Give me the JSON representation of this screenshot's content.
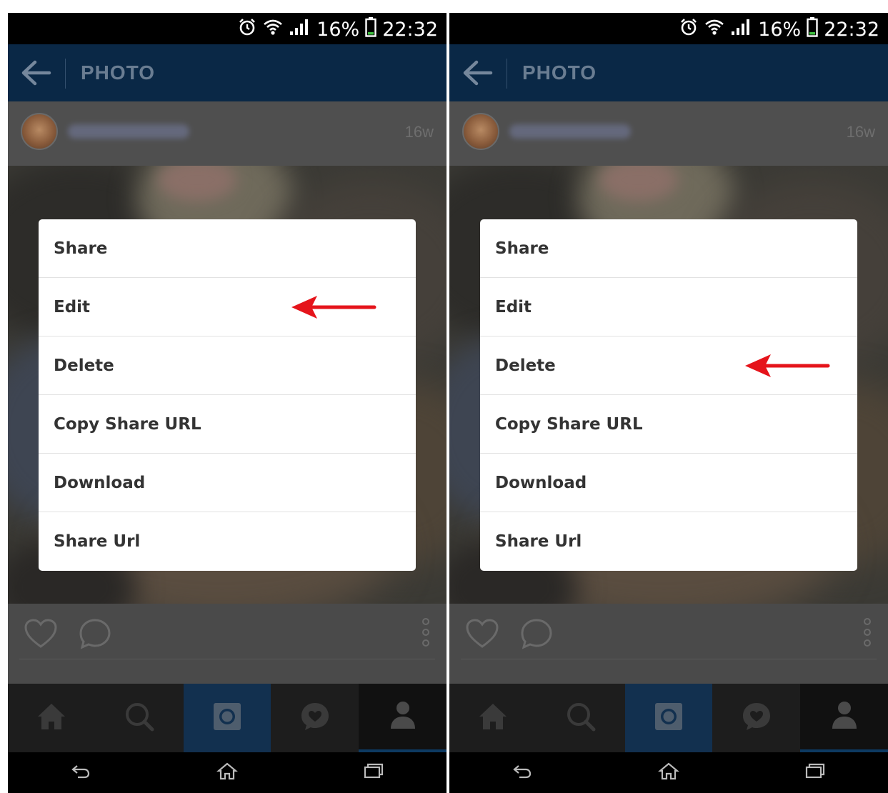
{
  "status_bar": {
    "battery_percent": "16%",
    "time": "22:32",
    "icons": [
      "alarm-icon",
      "wifi-icon",
      "signal-icon",
      "battery-icon"
    ]
  },
  "app_bar": {
    "title": "PHOTO",
    "back_icon": "back-arrow-icon"
  },
  "post": {
    "age": "16w"
  },
  "menu": {
    "items": [
      {
        "label": "Share"
      },
      {
        "label": "Edit"
      },
      {
        "label": "Delete"
      },
      {
        "label": "Copy Share URL"
      },
      {
        "label": "Download"
      },
      {
        "label": "Share Url"
      }
    ]
  },
  "screens": [
    {
      "name": "left",
      "arrow_points_to": "Edit"
    },
    {
      "name": "right",
      "arrow_points_to": "Delete"
    }
  ],
  "tab_bar": {
    "tabs": [
      "home-icon",
      "search-icon",
      "camera-icon",
      "activity-icon",
      "profile-icon"
    ]
  },
  "nav_bar": {
    "buttons": [
      "nav-back-icon",
      "nav-home-icon",
      "nav-recents-icon"
    ]
  },
  "colors": {
    "app_bar": "#0a2846",
    "active_tab": "#12304f",
    "arrow": "#e5141b",
    "menu_text": "#333333"
  }
}
